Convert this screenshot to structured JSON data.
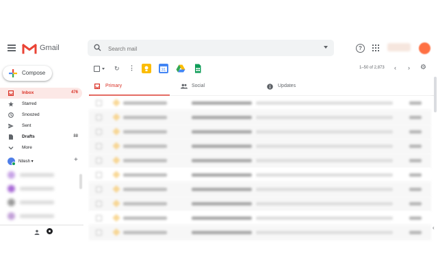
{
  "app": {
    "brand": "Gmail"
  },
  "search": {
    "placeholder": "Search mail"
  },
  "compose": {
    "label": "Compose"
  },
  "nav": {
    "items": [
      {
        "label": "Inbox",
        "count": "476"
      },
      {
        "label": "Starred",
        "count": ""
      },
      {
        "label": "Snoozed",
        "count": ""
      },
      {
        "label": "Sent",
        "count": ""
      },
      {
        "label": "Drafts",
        "count": "88"
      },
      {
        "label": "More",
        "count": ""
      }
    ]
  },
  "hangouts": {
    "user": "Nitesh",
    "add": "+"
  },
  "toolbar": {
    "refresh": "↻",
    "more": "⋮",
    "pager_text": "1–50 of 2,873",
    "prev": "‹",
    "next": "›",
    "settings": "⚙",
    "calendar_day": "31"
  },
  "tabs": [
    {
      "label": "Primary"
    },
    {
      "label": "Social"
    },
    {
      "label": "Updates"
    }
  ],
  "colors": {
    "accent": "#d93025",
    "inbox_bg": "#fce8e6",
    "search_bg": "#f1f3f4"
  },
  "icons": {
    "menu": "menu-icon",
    "search": "search-icon",
    "help": "help-icon",
    "apps": "apps-grid-icon",
    "settings": "gear-icon"
  }
}
